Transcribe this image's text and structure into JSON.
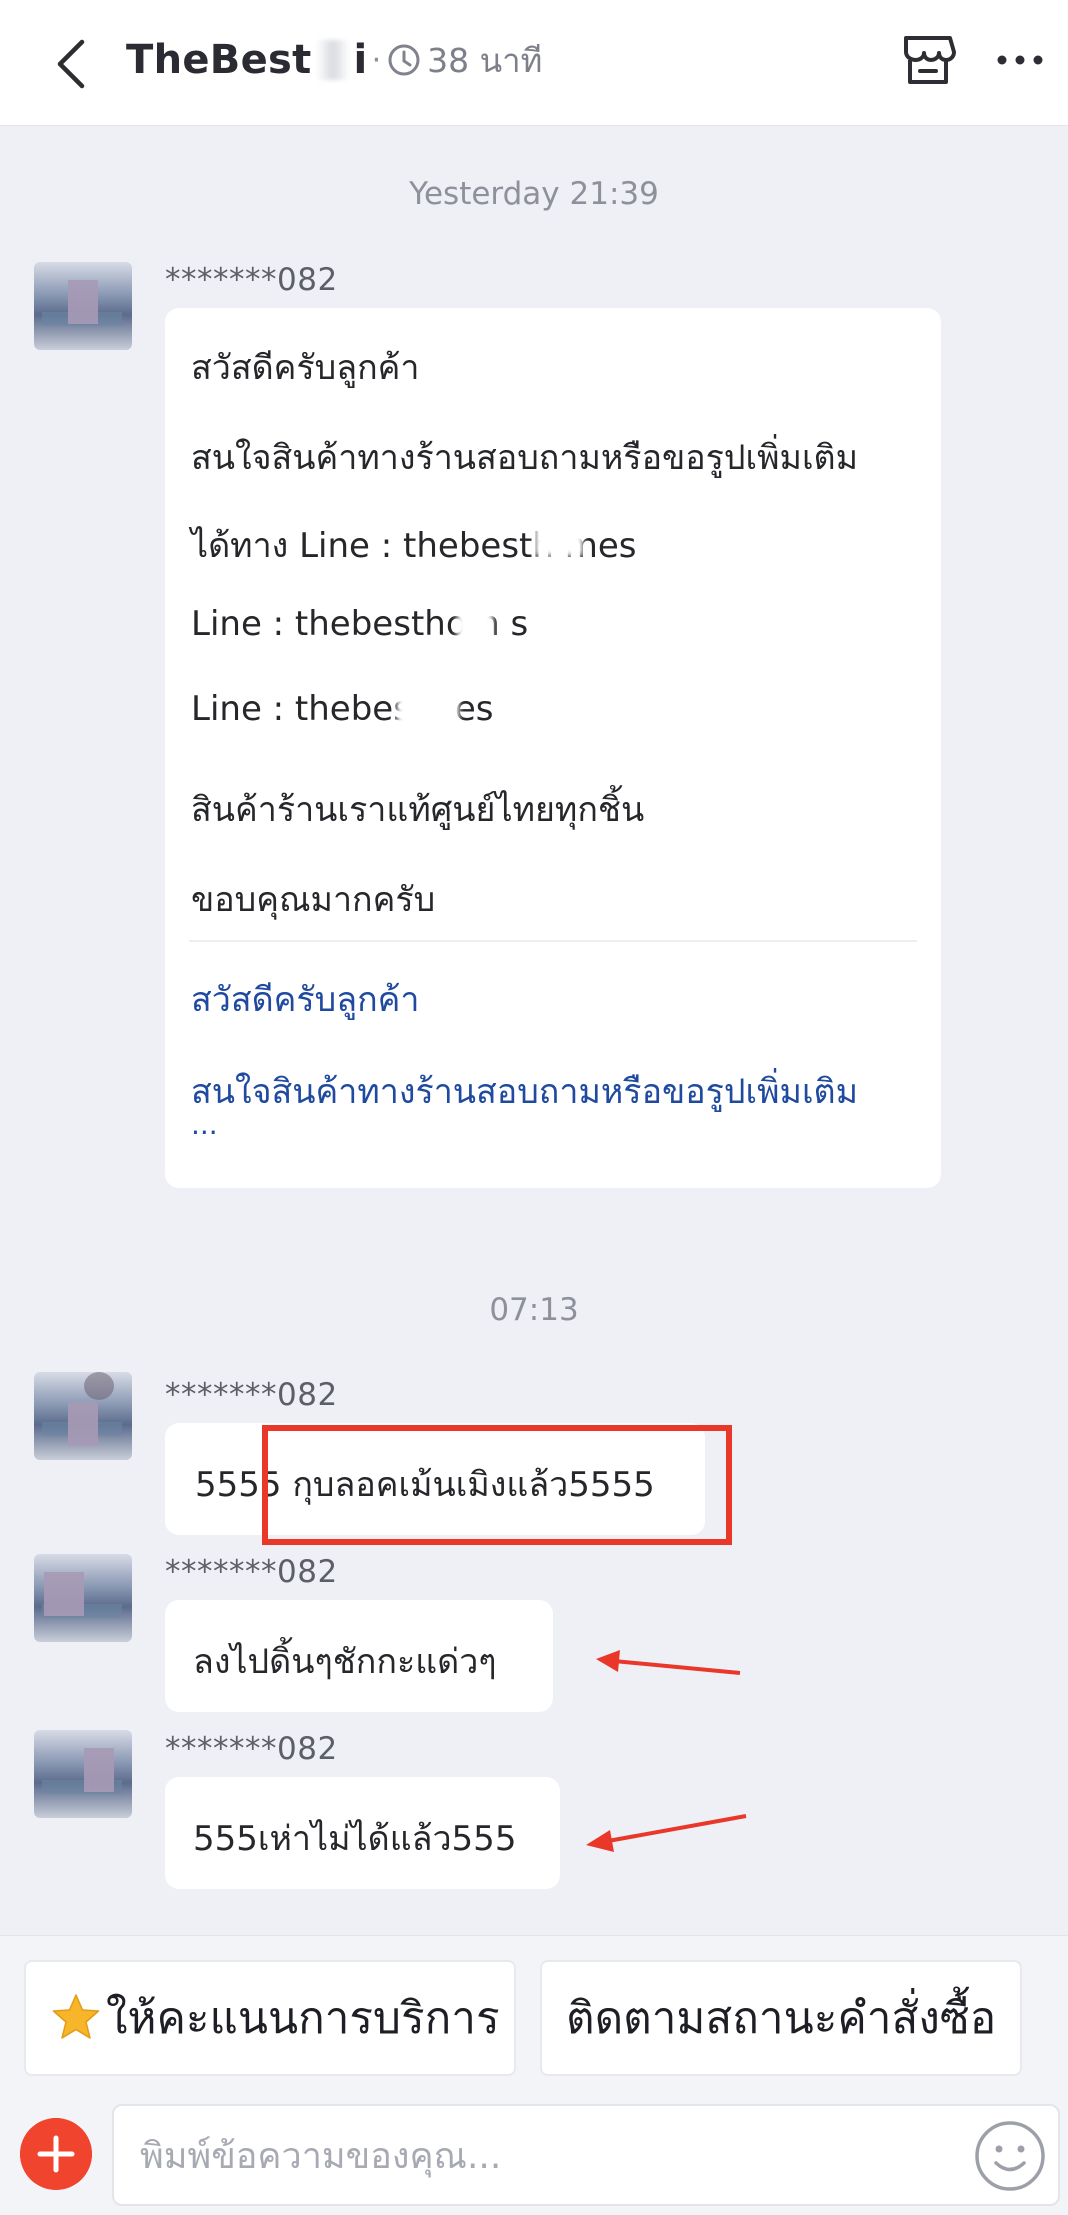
{
  "header": {
    "title": "TheBest",
    "title_tail": "i",
    "separator": "·",
    "last_seen": "38 นาที"
  },
  "chat": {
    "timestamps": [
      "Yesterday 21:39",
      "07:13"
    ],
    "messages": [
      {
        "sender": "*******082",
        "lines": [
          "สวัสดีครับลูกค้า",
          "สนใจสินค้าทางร้านสอบถามหรือขอรูปเพิ่มเติม",
          "ได้ทาง Line : thebesth mes",
          "Line : thebesthom s",
          "Line : thebes    mes",
          "สินค้าร้านเราแท้ศูนย์ไทยทุกชิ้น",
          "ขอบคุณมากครับ"
        ],
        "quick_replies": [
          "สวัสดีครับลูกค้า",
          "สนใจสินค้าทางร้านสอบถามหรือขอรูปเพิ่มเติม"
        ],
        "more": "..."
      },
      {
        "sender": "*******082",
        "text": "5555 กุบลอคเม้นเมิงแล้ว5555"
      },
      {
        "sender": "*******082",
        "text": "ลงไปดิ้นๆชักกะแด่วๆ"
      },
      {
        "sender": "*******082",
        "text": "555เห่าไม่ได้แล้ว555"
      }
    ]
  },
  "actions": {
    "rate_label": "ให้คะแนนการบริการ",
    "track_label": "ติดตามสถานะคำสั่งซื้อ"
  },
  "composer": {
    "placeholder": "พิมพ์ข้อความของคุณ..."
  },
  "colors": {
    "accent_red": "#f0442f",
    "annotation_red": "#e9372a",
    "link_blue": "#1f4aa0",
    "background": "#eef0f5"
  },
  "icons": [
    "back-icon",
    "clock-icon",
    "shop-icon",
    "more-icon",
    "star-icon",
    "plus-icon",
    "emoji-icon"
  ]
}
